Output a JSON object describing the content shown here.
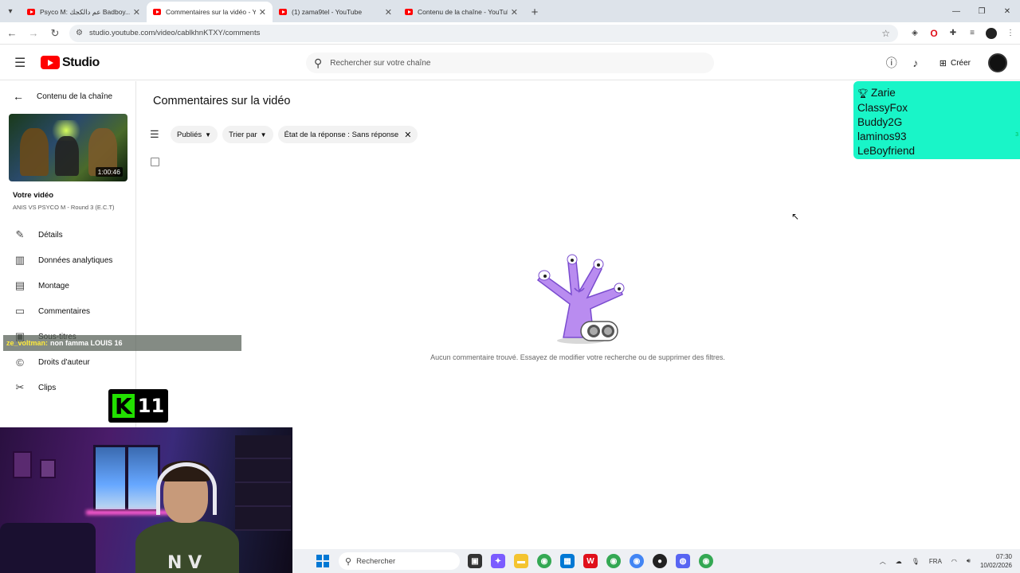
{
  "browser": {
    "tabs": [
      {
        "title": "Psyco M: عم دالكجك Badboy...",
        "active": false
      },
      {
        "title": "Commentaires sur la vidéo - Yo",
        "active": true
      },
      {
        "title": "(1) zama9tel - YouTube",
        "active": false
      },
      {
        "title": "Contenu de la chaîne - YouTube",
        "active": false
      }
    ],
    "url": "studio.youtube.com/video/cablkhnKTXY/comments"
  },
  "header": {
    "logo_text": "Studio",
    "search_placeholder": "Rechercher sur votre chaîne",
    "create_label": "Créer"
  },
  "sidebar": {
    "back_label": "Contenu de la chaîne",
    "thumbnail_duration": "1:00:46",
    "your_video_label": "Votre vidéo",
    "video_title": "ANIS VS PSYCO M - Round 3 (E.C.T)",
    "items": [
      {
        "label": "Détails",
        "icon": "pencil-icon"
      },
      {
        "label": "Données analytiques",
        "icon": "analytics-icon"
      },
      {
        "label": "Montage",
        "icon": "film-icon"
      },
      {
        "label": "Commentaires",
        "icon": "comment-icon"
      },
      {
        "label": "Sous-titres",
        "icon": "subtitles-icon"
      },
      {
        "label": "Droits d'auteur",
        "icon": "copyright-icon"
      },
      {
        "label": "Clips",
        "icon": "scissors-icon"
      }
    ]
  },
  "main": {
    "title": "Commentaires sur la vidéo",
    "filters": {
      "published": "Publiés",
      "sort": "Trier par",
      "reply_state": "État de la réponse : Sans réponse"
    },
    "empty_message": "Aucun commentaire trouvé. Essayez de modifier votre recherche ou de supprimer des filtres."
  },
  "overlay": {
    "leaderboard": [
      "Zarie",
      "ClassyFox",
      "Buddy2G",
      "laminos93",
      "LeBoyfriend"
    ],
    "leaderboard_edge": "3",
    "chat_user": "ze_voltman:",
    "chat_message": "non famma LOUIS 16",
    "badge_letter": "K",
    "badge_number": "11",
    "shirt_text": "N V"
  },
  "taskbar": {
    "search_label": "Rechercher",
    "language": "FRA",
    "time": "07:30",
    "date": "10/02/2026"
  },
  "colors": {
    "youtube_red": "#ff0000",
    "leaderboard_bg": "#19f5c8",
    "badge_green": "#22e000",
    "illustration_purple": "#b98cf0"
  }
}
